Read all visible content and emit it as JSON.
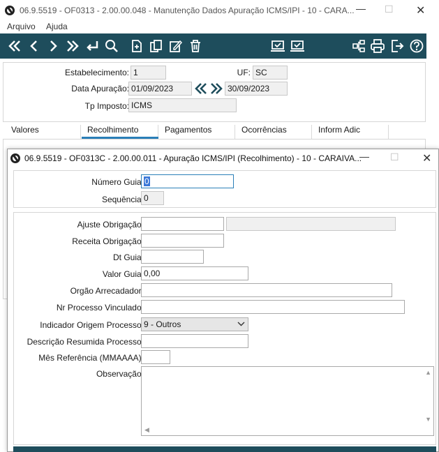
{
  "main_window": {
    "title": "06.9.5519 - OF0313 - 2.00.00.048 - Manutenção Dados Apuração ICMS/IPI - 10 - CARA...",
    "menu": [
      "Arquivo",
      "Ajuda"
    ],
    "fields": {
      "estabelecimento_label": "Estabelecimento:",
      "estabelecimento_value": "1",
      "uf_label": "UF:",
      "uf_value": "SC",
      "data_label": "Data Apuração:",
      "data_inicio": "01/09/2023",
      "data_fim": "30/09/2023",
      "tp_label": "Tp Imposto:",
      "tp_value": "ICMS"
    },
    "tabs": [
      "Valores",
      "Recolhimento",
      "Pagamentos",
      "Ocorrências",
      "Inform Adic"
    ],
    "active_tab": "Recolhimento"
  },
  "child_window": {
    "title": "06.9.5519 - OF0313C - 2.00.00.011 - Apuração ICMS/IPI (Recolhimento) - 10 - CARAIVA...",
    "numero_guia_label": "Número Guia:",
    "numero_guia_value": "0",
    "sequencia_label": "Sequência:",
    "sequencia_value": "0",
    "ajuste_label": "Ajuste Obrigação:",
    "ajuste_value": "",
    "ajuste_desc": "",
    "receita_label": "Receita Obrigação:",
    "receita_value": "",
    "dt_guia_label": "Dt Guia:",
    "dt_guia_value": "",
    "valor_guia_label": "Valor Guia:",
    "valor_guia_value": "0,00",
    "orgao_label": "Orgão Arrecadador:",
    "orgao_value": "",
    "nr_processo_label": "Nr Processo Vinculado:",
    "nr_processo_value": "",
    "indicador_label": "Indicador Origem Processo:",
    "indicador_value": "9 - Outros",
    "descricao_label": "Descrição Resumida Processo:",
    "descricao_value": "",
    "mes_label": "Mês Referência (MMAAAA):",
    "mes_value": "",
    "observacao_label": "Observação:",
    "observacao_value": ""
  },
  "colors": {
    "toolbar_bg": "#1e4d5c",
    "tab_accent": "#2a7fb8"
  }
}
